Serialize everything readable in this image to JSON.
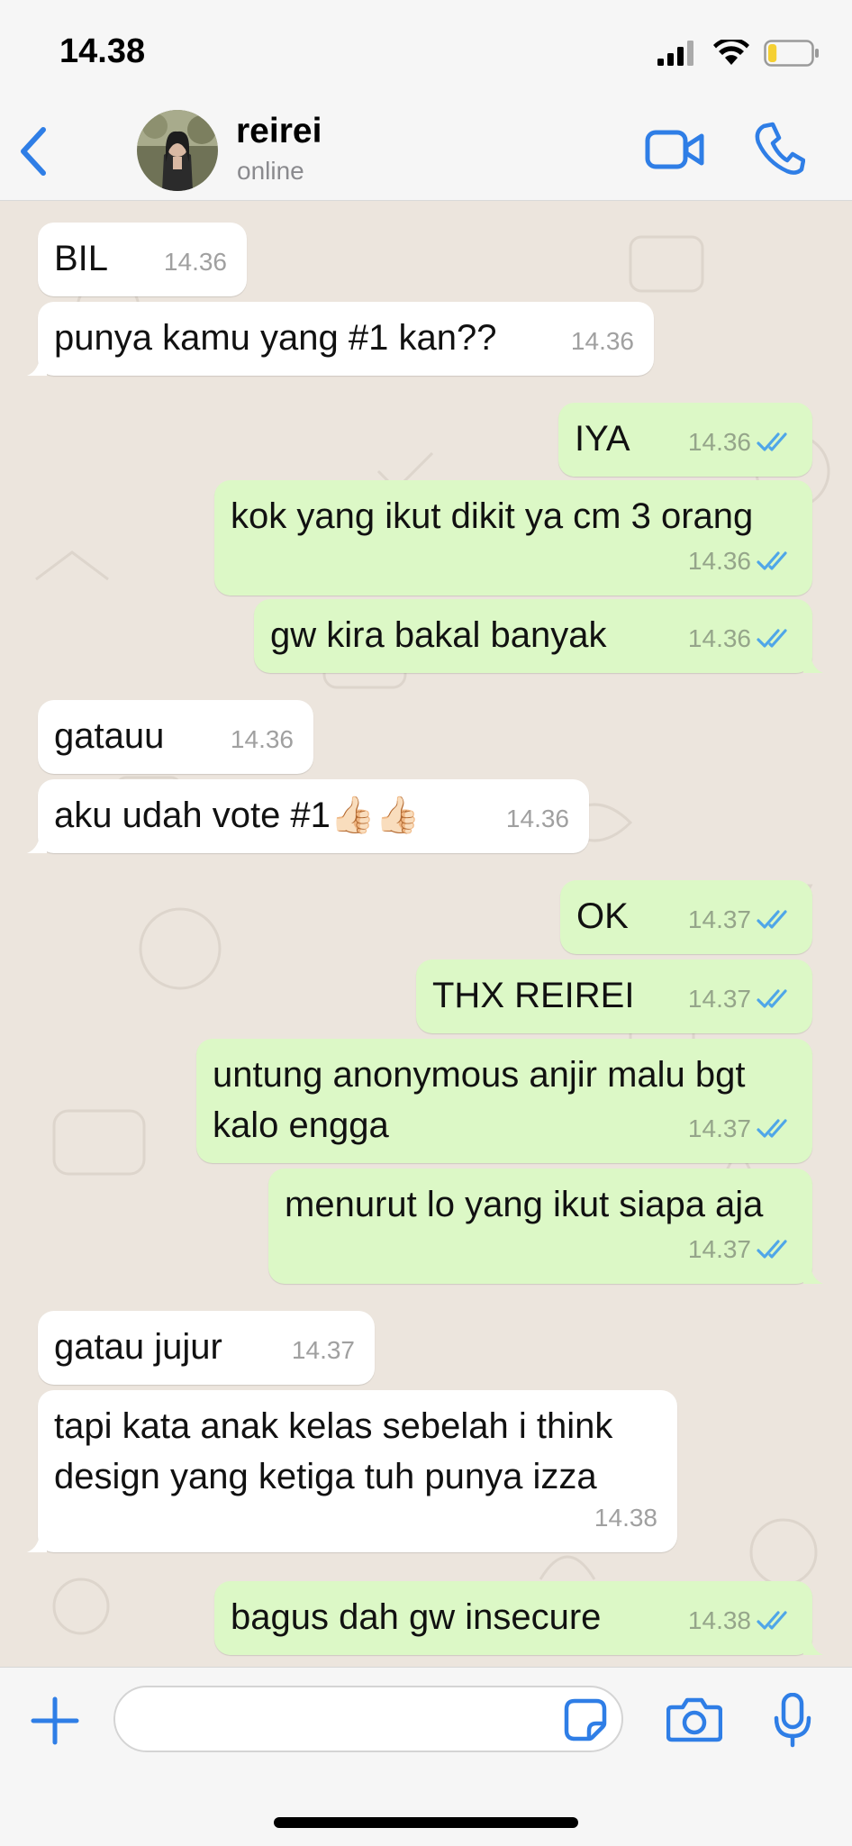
{
  "status_bar": {
    "time": "14.38",
    "battery_level": 0.2
  },
  "header": {
    "contact_name": "reirei",
    "contact_status": "online"
  },
  "colors": {
    "accent": "#2f7ee6",
    "incoming_bubble": "#ffffff",
    "outgoing_bubble": "#dcf8c6",
    "read_tick": "#4fa6e8",
    "wallpaper": "#ece5dd"
  },
  "messages": [
    {
      "direction": "in",
      "text": "BIL",
      "time": "14.36"
    },
    {
      "direction": "in",
      "text": "punya kamu yang #1 kan??",
      "time": "14.36"
    },
    {
      "direction": "out",
      "text": "IYA",
      "time": "14.36",
      "status": "read"
    },
    {
      "direction": "out",
      "text": "kok yang ikut dikit ya cm 3 orang",
      "time": "14.36",
      "status": "read"
    },
    {
      "direction": "out",
      "text": "gw kira bakal banyak",
      "time": "14.36",
      "status": "read"
    },
    {
      "direction": "in",
      "text": "gatauu",
      "time": "14.36"
    },
    {
      "direction": "in",
      "text": "aku udah vote #1👍🏻👍🏻",
      "time": "14.36"
    },
    {
      "direction": "out",
      "text": "OK",
      "time": "14.37",
      "status": "read"
    },
    {
      "direction": "out",
      "text": "THX REIREI",
      "time": "14.37",
      "status": "read"
    },
    {
      "direction": "out",
      "text": "untung anonymous anjir malu bgt\nkalo engga",
      "time": "14.37",
      "status": "read"
    },
    {
      "direction": "out",
      "text": "menurut lo yang ikut siapa aja",
      "time": "14.37",
      "status": "read"
    },
    {
      "direction": "in",
      "text": "gatau jujur",
      "time": "14.37"
    },
    {
      "direction": "in",
      "text": "tapi kata anak kelas sebelah i think\ndesign yang ketiga tuh punya izza",
      "time": "14.38"
    },
    {
      "direction": "out",
      "text": "bagus dah gw insecure",
      "time": "14.38",
      "status": "read"
    }
  ],
  "input": {
    "value": "",
    "placeholder": ""
  },
  "icons": {
    "back": "chevron-left-icon",
    "video": "video-camera-icon",
    "call": "phone-icon",
    "plus": "plus-icon",
    "sticker": "sticker-icon",
    "camera": "camera-icon",
    "mic": "microphone-icon"
  }
}
